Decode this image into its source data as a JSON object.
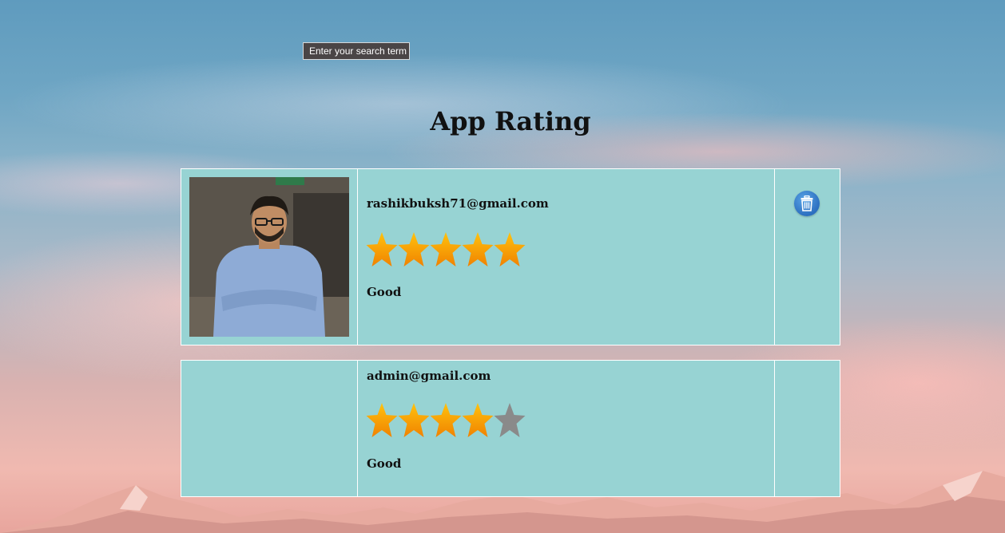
{
  "search": {
    "placeholder": "Enter your search term",
    "value": ""
  },
  "header": {
    "title": "App Rating"
  },
  "reviews": [
    {
      "email": "rashikbuksh71@gmail.com",
      "rating": 5,
      "max_rating": 5,
      "comment": "Good",
      "has_photo": true,
      "has_delete": true
    },
    {
      "email": "admin@gmail.com",
      "rating": 4,
      "max_rating": 5,
      "comment": "Good",
      "has_photo": false,
      "has_delete": false
    }
  ],
  "icons": {
    "delete": "trash-icon",
    "star_filled": "star-filled-icon",
    "star_empty": "star-empty-icon"
  },
  "colors": {
    "card_bg": "#97d3d3",
    "star_filled": "#ff9f00",
    "star_empty": "#8a8a8a",
    "delete_button": "#2f7fd0",
    "search_bg": "#4a4546"
  }
}
